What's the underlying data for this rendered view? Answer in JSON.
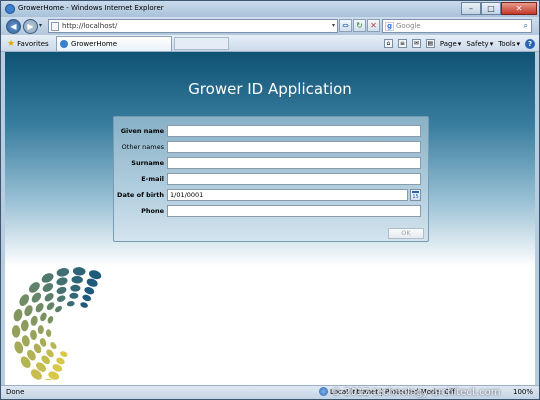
{
  "window": {
    "title": "GrowerHome - Windows Internet Explorer",
    "min_glyph": "–",
    "max_glyph": "□",
    "close_glyph": "✕"
  },
  "address_bar": {
    "url": "http://localhost/",
    "search_placeholder": "Google",
    "back_glyph": "◀",
    "forward_glyph": "▶",
    "dropdown_glyph": "▾",
    "compat_glyph": "⇔",
    "refresh_glyph": "↻",
    "stop_glyph": "✕",
    "search_go_glyph": "⌕"
  },
  "favorites_bar": {
    "favorites_label": "Favorites",
    "tab_label": "GrowerHome",
    "commands": [
      {
        "label": "Page",
        "icon": "page-icon"
      },
      {
        "label": "Safety",
        "icon": "safety-icon"
      },
      {
        "label": "Tools",
        "icon": "tools-icon"
      }
    ],
    "help_glyph": "?"
  },
  "page": {
    "title": "Grower ID Application",
    "form": {
      "fields": {
        "given_name": {
          "label": "Given name",
          "value": ""
        },
        "other_names": {
          "label": "Other names",
          "value": ""
        },
        "surname": {
          "label": "Surname",
          "value": ""
        },
        "email": {
          "label": "E-mail",
          "value": ""
        },
        "date_of_birth": {
          "label": "Date of birth",
          "value": "1/01/0001"
        },
        "phone": {
          "label": "Phone",
          "value": ""
        }
      },
      "calendar_glyph": "15",
      "ok_label": "OK"
    }
  },
  "status_bar": {
    "status": "Done",
    "zone": "Local intranet | Protected Mode: Off",
    "zoom": "100%"
  },
  "watermark": "© 2012 technology-architect.com",
  "colors": {
    "banner_top": "#0f5273",
    "logo_dark": "#1d5a7c",
    "logo_light": "#d8c84a"
  }
}
